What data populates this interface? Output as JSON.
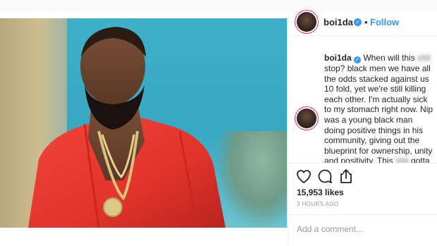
{
  "post": {
    "username": "boi1da",
    "follow_label": "Follow",
    "separator": "•",
    "verified_glyph": "✓",
    "image_alt": "Photo of a man in a red jacket wearing gold chains"
  },
  "caption": {
    "username": "boi1da",
    "segments": [
      {
        "text": " When will this ",
        "blurred": false
      },
      {
        "text": "shit",
        "blurred": true
      },
      {
        "text": " stop? black men we have all the odds stacked against us 10 fold, yet we're still killing each other. I'm actually sick to my stomach right now. Nip was a young black man doing positive things in his community, giving out the blueprint for ownership, unity and positivity. This ",
        "blurred": false
      },
      {
        "text": "shit",
        "blurred": true
      },
      {
        "text": " gotta stop, they're already trying to hold us down any way possible. RIP Nip, your words and lessons won't go in vain.",
        "blurred": false
      }
    ]
  },
  "stats": {
    "likes": "15,953 likes",
    "timestamp": "3 HOURS AGO"
  },
  "comment": {
    "placeholder": "Add a comment..."
  },
  "icons": [
    "heart-icon",
    "comment-icon",
    "share-icon",
    "verified-icon"
  ],
  "colors": {
    "link_blue": "#3897f0",
    "text": "#262626",
    "muted": "#999999",
    "verified": "#3897f0",
    "jacket_red": "#e8332a"
  }
}
